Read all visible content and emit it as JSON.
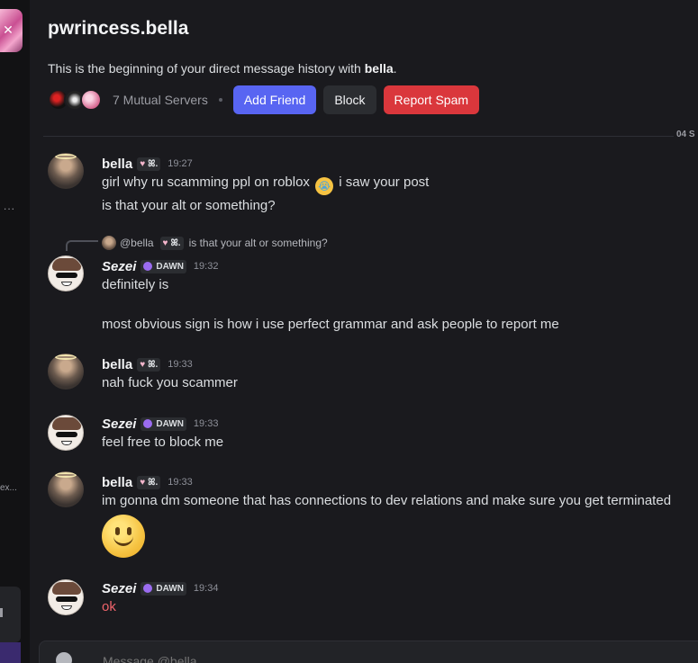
{
  "dm": {
    "title": "pwrincess.bella",
    "intro_prefix": "This is the beginning of your direct message history with ",
    "intro_name": "bella",
    "intro_suffix": ".",
    "mutual_servers": "7 Mutual Servers",
    "buttons": {
      "add_friend": "Add Friend",
      "block": "Block",
      "report_spam": "Report Spam"
    },
    "date_divider": "04 S"
  },
  "sidebar": {
    "dots": "...",
    "truncated_text": "ex..."
  },
  "tags": {
    "bella": "ꕤ.",
    "sezei": "DAWN"
  },
  "messages": [
    {
      "author": "bella",
      "time": "19:27",
      "lines": [
        "girl why ru scamming ppl on roblox",
        "i saw your post",
        "is that your alt or something?"
      ]
    },
    {
      "author": "Sezei",
      "time": "19:32",
      "reply_to": "@bella",
      "reply_text": "is that your alt or something?",
      "lines": [
        "definitely is",
        "most obvious sign is how i use perfect grammar and ask people to report  me"
      ]
    },
    {
      "author": "bella",
      "time": "19:33",
      "lines": [
        "nah fuck you scammer"
      ]
    },
    {
      "author": "Sezei",
      "time": "19:33",
      "lines": [
        "feel free to block me"
      ]
    },
    {
      "author": "bella",
      "time": "19:33",
      "lines": [
        "im gonna dm someone that has connections to dev relations and make sure you get terminated"
      ]
    },
    {
      "author": "Sezei",
      "time": "19:34",
      "lines": [
        "ok"
      ]
    }
  ],
  "composer": {
    "placeholder": "Message @bella"
  },
  "colors": {
    "accent": "#5865f2",
    "danger": "#da373c",
    "ok_text": "#f0646b"
  }
}
